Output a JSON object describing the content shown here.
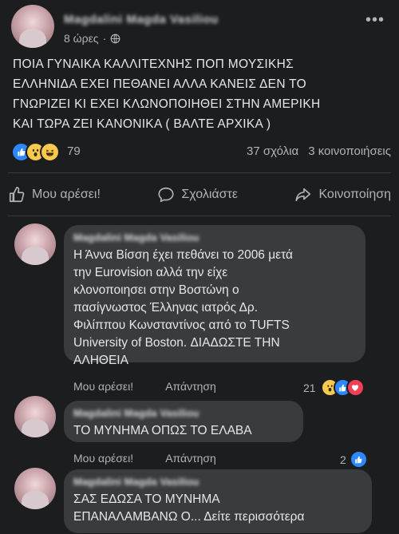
{
  "post": {
    "author": "Magdalini Magda Vasiliou",
    "time": "8 ώρες",
    "separator": "·",
    "text_lines": [
      "ΠΟΙΑ ΓΥΝΑΙΚΑ ΚΑΛΛΙΤΕΧΝΗΣ ΠΟΠ  ΜΟΥΣΙΚΗΣ",
      "ΕΛΛΗΝΙΔΑ  ΕΧΕΙ ΠΕΘΑΝΕΙ  ΑΛΛΑ ΚΑΝΕΙΣ ΔΕΝ ΤΟ",
      "ΓΝΩΡΙΖΕΙ  ΚΙ  ΕΧΕΙ ΚΛΩΝΟΠΟΙΗΘΕΙ ΣΤΗΝ ΑΜΕΡΙΚΗ",
      "ΚΑΙ ΤΩΡΑ ΖΕΙ ΚΑΝΟΝΙΚΑ ( ΒΑΛΤΕ ΑΡΧΙΚΑ )"
    ],
    "reaction_count": "79",
    "comments_count": "37 σχόλια",
    "shares_count": "3 κοινοποιήσεις"
  },
  "actions": {
    "like": "Μου αρέσει!",
    "comment": "Σχολιάστε",
    "share": "Κοινοποίηση"
  },
  "comments": [
    {
      "author": "Magdalini Magda Vasiliou",
      "text_lines": [
        "Η Άννα Βίσση έχει πεθάνει το 2006 μετά",
        "την Eurovision αλλά την είχε",
        "κλονοποιησει στην Βοστώνη ο",
        "πασίγνωστος Έλληνας ιατρός Δρ.",
        "Φιλίππου Κωνσταντίνος από το TUFTS",
        "University of Boston. ΔΙΑΔΩΣΤΕ ΤΗΝ",
        "ΑΛΗΘΕΙΑ"
      ],
      "like_label": "Μου αρέσει!",
      "reply_label": "Απάντηση",
      "reaction_count": "21"
    },
    {
      "author": "Magdalini Magda Vasiliou",
      "text_lines": [
        "ΤΟ ΜΥΝΗΜΑ ΟΠΩΣ ΤΟ ΕΛΑΒΑ"
      ],
      "like_label": "Μου αρέσει!",
      "reply_label": "Απάντηση",
      "reaction_count": "2"
    },
    {
      "author": "Magdalini Magda Vasiliou",
      "text_lines": [
        "ΣΑΣ  ΕΔΩΣΑ ΤΟ ΜΥΝΗΜΑ",
        "ΕΠΑΝΑΛΑΜΒΑΝΩ Ο... Δείτε περισσότερα"
      ]
    }
  ],
  "colors": {
    "background": "#1c1d1f",
    "bubble": "#3a3b3c",
    "text": "#e4e6eb",
    "muted": "#b0b3b8",
    "like_blue": "#2d88ff",
    "love_red": "#f33e58",
    "wow_yellow": "#f7c94f"
  },
  "icons": [
    "globe-icon",
    "more-icon",
    "like-reaction-icon",
    "wow-reaction-icon",
    "haha-reaction-icon",
    "love-reaction-icon",
    "thumbs-up-icon",
    "comment-bubble-icon",
    "share-arrow-icon"
  ]
}
